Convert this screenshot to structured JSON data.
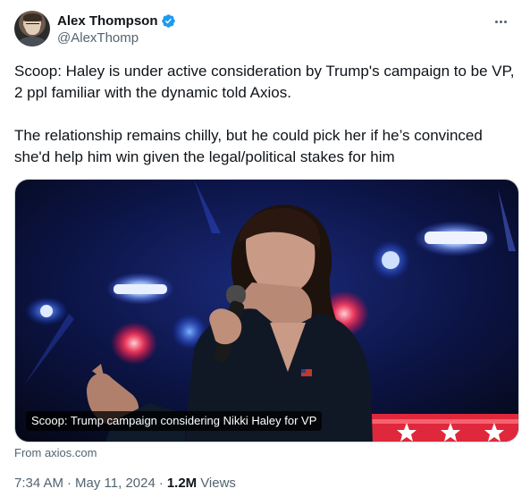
{
  "author": {
    "display_name": "Alex Thompson",
    "handle": "@AlexThomp",
    "verified": true,
    "verified_color": "#1d9bf0"
  },
  "more_icon": "more-horizontal-icon",
  "tweet": {
    "text": "Scoop: Haley is under active consideration by Trump's campaign to be VP, 2 ppl familiar with the dynamic told Axios.\n\nThe relationship remains chilly, but he could pick her if he’s convinced she'd help him win given the legal/political stakes for him"
  },
  "card": {
    "caption": "Scoop: Trump campaign considering Nikki Haley for VP",
    "source": "From axios.com"
  },
  "meta": {
    "time": "7:34 AM",
    "date": "May 11, 2024",
    "separator": "·",
    "views_count": "1.2M",
    "views_label": "Views"
  },
  "colors": {
    "text_primary": "#0f1419",
    "text_secondary": "#536471",
    "border": "#cfd9de"
  }
}
